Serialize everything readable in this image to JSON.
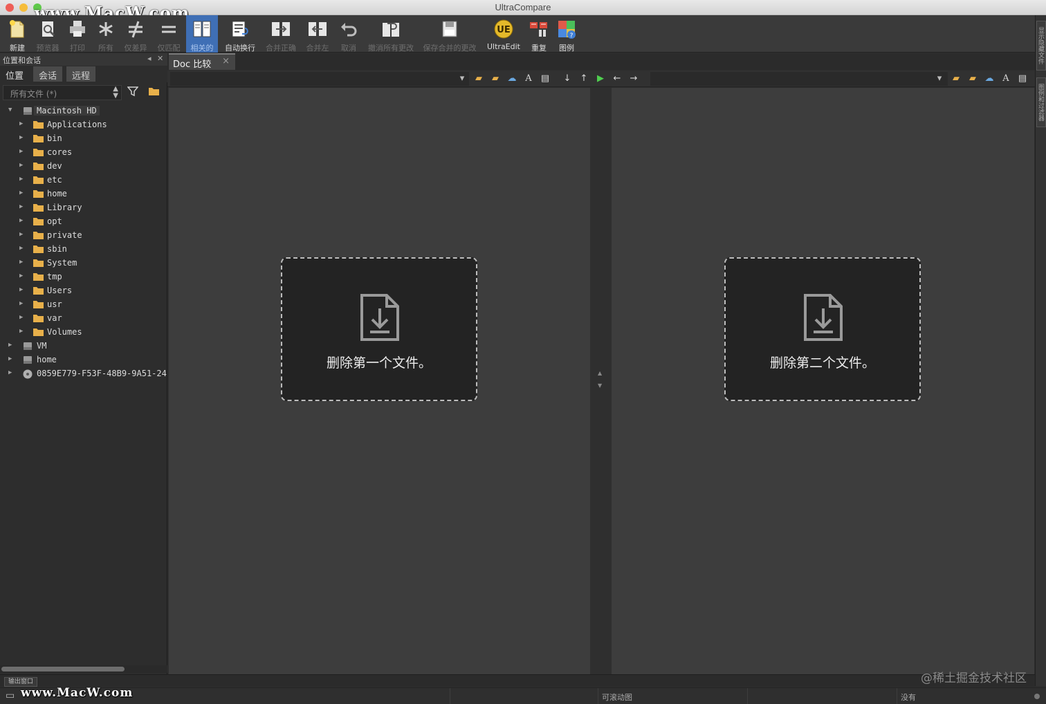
{
  "window": {
    "title": "UltraCompare"
  },
  "watermark": {
    "top": "www.MacW.com",
    "bottom": "www.MacW.com"
  },
  "toolbar": {
    "new": "新建",
    "preview": "预览器",
    "print": "打印",
    "all": "所有",
    "diff_only": "仅差异",
    "match_only": "仅匹配",
    "related": "相关的",
    "auto_wrap": "自动换行",
    "merge_right": "合并正确",
    "merge_left": "合并左",
    "undo": "取消",
    "undo_all": "撤消所有更改",
    "save_merge": "保存合并的更改",
    "ultraedit": "UltraEdit",
    "repeat": "重复",
    "legend": "图例"
  },
  "right_dock": {
    "tab1": "显示隐藏文件",
    "tab2": "图例和过滤器"
  },
  "left_panel": {
    "title": "位置和会话",
    "tabs": [
      "位置",
      "会话",
      "远程"
    ],
    "filter": "所有文件 (*)",
    "tree": {
      "root": "Macintosh HD",
      "children": [
        "Applications",
        "bin",
        "cores",
        "dev",
        "etc",
        "home",
        "Library",
        "opt",
        "private",
        "sbin",
        "System",
        "tmp",
        "Users",
        "usr",
        "var",
        "Volumes"
      ],
      "others": [
        "VM",
        "home",
        "0859E779-F53F-48B9-9A51-24"
      ]
    }
  },
  "doc_tab": {
    "label": "Doc 比较",
    "close": "×"
  },
  "panes": {
    "left_drop": "删除第一个文件。",
    "right_drop": "删除第二个文件。"
  },
  "bottom": {
    "output_tab": "输出窗口",
    "credit": "@稀土掘金技术社区",
    "status_scroll": "可滚动图",
    "status_none": "没有"
  },
  "colors": {
    "accent": "#3f6fb5",
    "pane_bg": "#3d3d3d",
    "drop_bg": "#232323"
  }
}
